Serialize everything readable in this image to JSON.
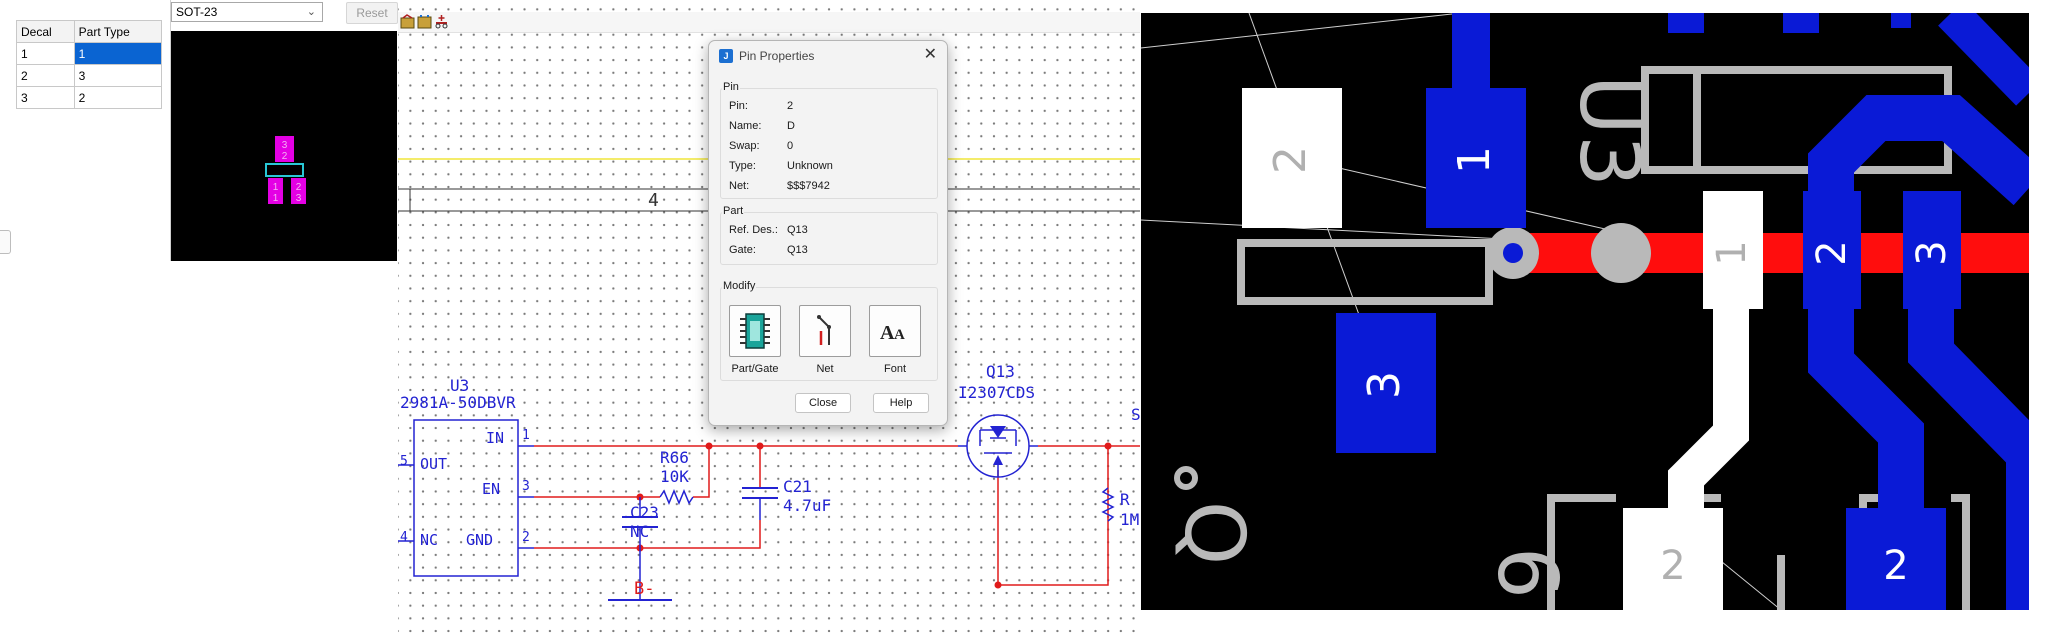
{
  "pin_table": {
    "headers": [
      "Decal",
      "Part Type"
    ],
    "rows": [
      {
        "decal": "1",
        "part_type": "1",
        "selected": true
      },
      {
        "decal": "2",
        "part_type": "3",
        "selected": false
      },
      {
        "decal": "3",
        "part_type": "2",
        "selected": false
      }
    ]
  },
  "decal_panel": {
    "decal_value": "SOT-23",
    "reset_label": "Reset",
    "preview_pads": [
      {
        "top": "3",
        "bottom": "2"
      },
      {
        "top": "1",
        "bottom": "1"
      },
      {
        "top": "2",
        "bottom": "3"
      }
    ]
  },
  "schematic": {
    "sheet_number": "4",
    "u3": {
      "ref": "U3",
      "value": "2981A-50DBVR",
      "pins": {
        "in": "IN",
        "out": "OUT",
        "en": "EN",
        "nc": "NC",
        "gnd": "GND"
      },
      "pin_numbers": {
        "in": "1",
        "en": "3",
        "gnd": "2",
        "out": "5",
        "nc": "4"
      }
    },
    "r66": {
      "ref": "R66",
      "value": "10K"
    },
    "c21": {
      "ref": "C21",
      "value": "4.7uF"
    },
    "c23": {
      "ref": "C23",
      "value": "NC"
    },
    "q13": {
      "ref": "Q13",
      "value": "I2307CDS"
    },
    "r_right": {
      "ref": "R",
      "value": "1M"
    },
    "net_bminus": "B-",
    "edge_s": "S",
    "colors": {
      "part": "#2323d2",
      "wire": "#e01b1b",
      "bus": "#f0e63a"
    }
  },
  "dialog": {
    "title": "Pin Properties",
    "pin_group": "Pin",
    "pin_fields": [
      {
        "label": "Pin:",
        "value": "2"
      },
      {
        "label": "Name:",
        "value": "D"
      },
      {
        "label": "Swap:",
        "value": "0"
      },
      {
        "label": "Type:",
        "value": "Unknown"
      },
      {
        "label": "Net:",
        "value": "$$$7942"
      }
    ],
    "part_group": "Part",
    "part_fields": [
      {
        "label": "Ref. Des.:",
        "value": "Q13"
      },
      {
        "label": "Gate:",
        "value": "Q13"
      }
    ],
    "modify_group": "Modify",
    "modify_buttons": [
      {
        "label": "Part/Gate",
        "icon": "chip-icon"
      },
      {
        "label": "Net",
        "icon": "net-icon"
      },
      {
        "label": "Font",
        "icon": "font-icon"
      }
    ],
    "close_label": "Close",
    "help_label": "Help"
  },
  "pcb": {
    "silk_u3": "U3",
    "silk_q": "Q",
    "silk_6": "6",
    "pads": {
      "left_white": "2",
      "left_blue_top": "1",
      "left_blue_bottom": "3",
      "center_white": "1",
      "right_blue_a": "2",
      "right_blue_b": "3",
      "bottom_white": "2",
      "bottom_blue": "2"
    },
    "colors": {
      "top": "#0a1ad6",
      "trace": "#ff0d0d",
      "silk": "#b9b9b9",
      "pad_white": "#ffffff"
    }
  }
}
